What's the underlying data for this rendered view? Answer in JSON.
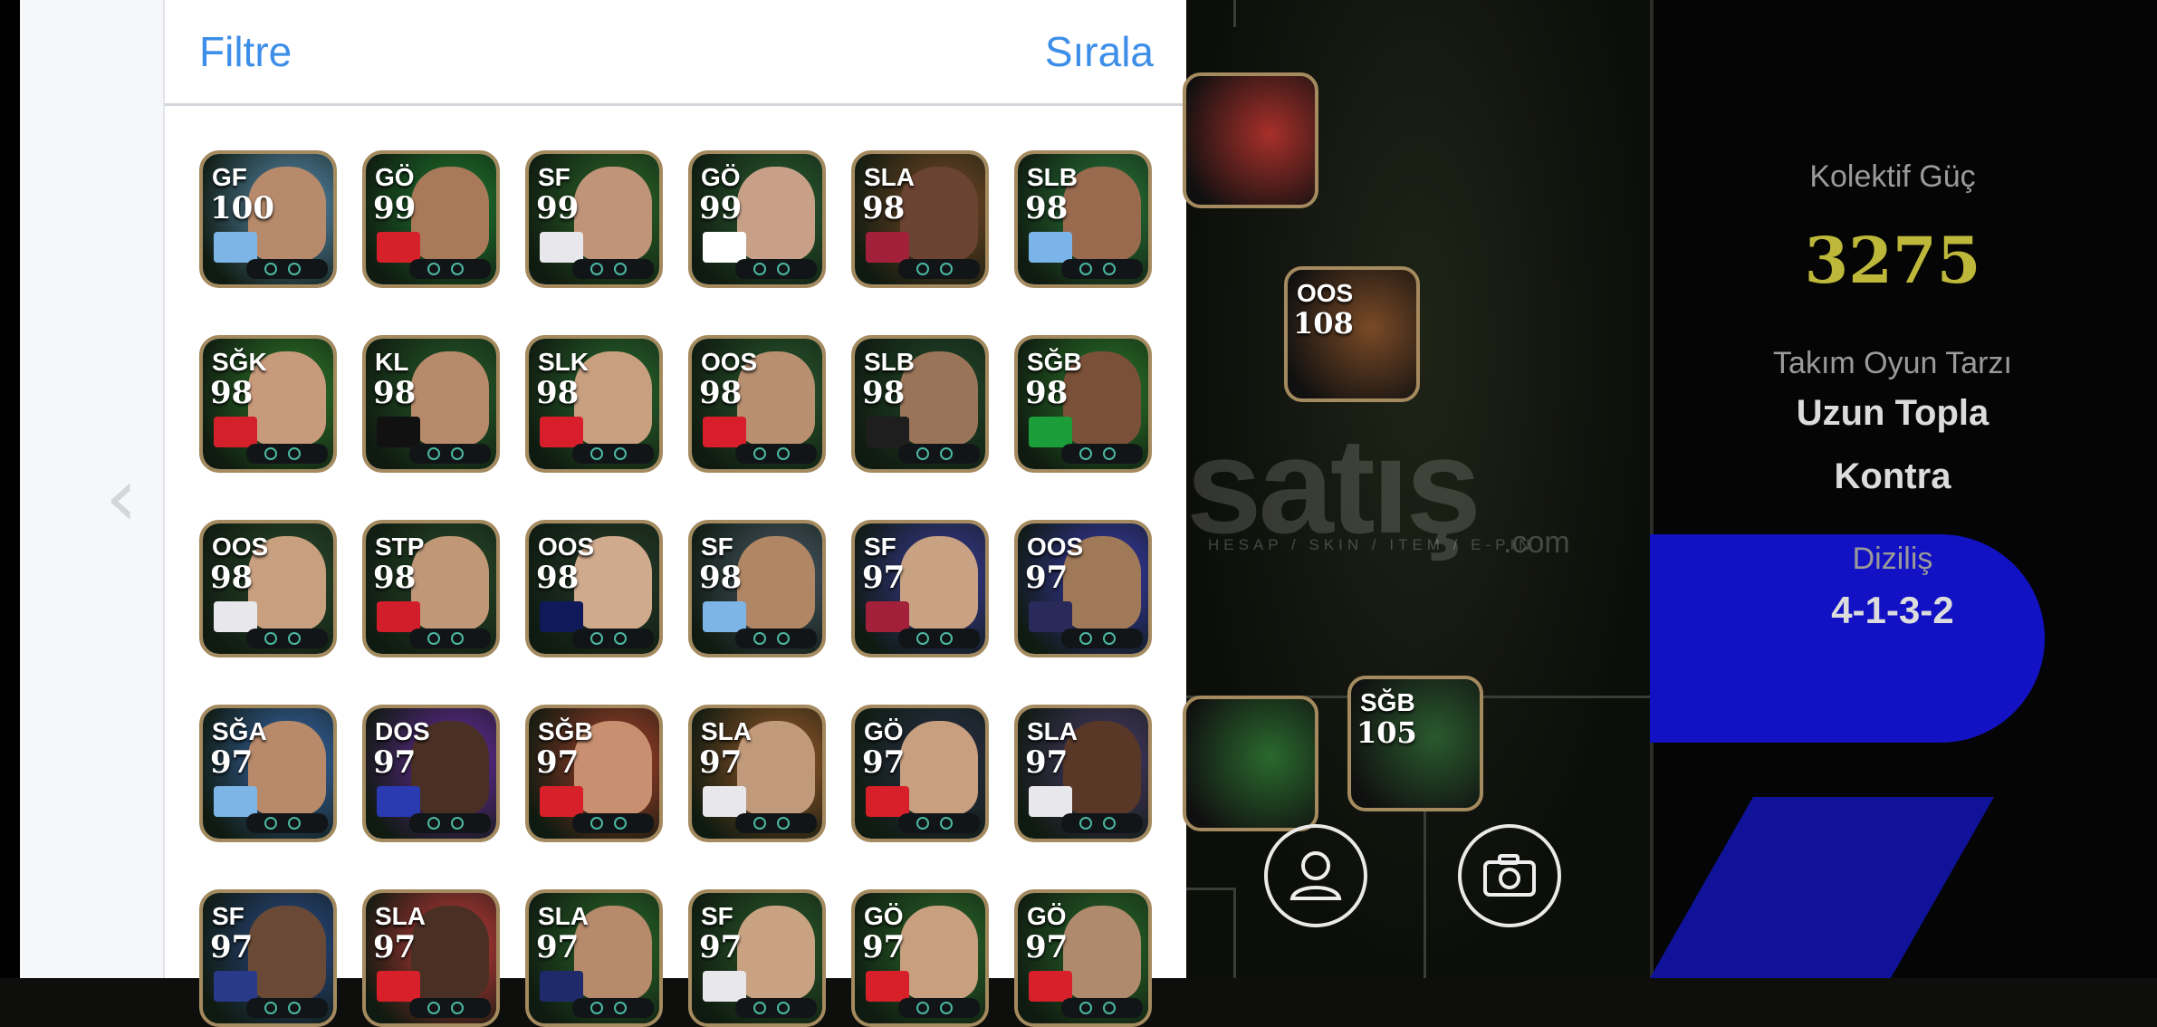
{
  "header": {
    "filter_label": "Filtre",
    "sort_label": "Sırala"
  },
  "back_icon": "chevron-left-icon",
  "players": [
    {
      "pos": "GF",
      "rating": "100",
      "theme": "#5a8fb5",
      "head": "#b68a6a",
      "emblem": "#7db6e6"
    },
    {
      "pos": "GÖ",
      "rating": "99",
      "theme": "#1f7a2e",
      "head": "#a87a5a",
      "emblem": "#d6202a"
    },
    {
      "pos": "SF",
      "rating": "99",
      "theme": "#2c6a2a",
      "head": "#c09478",
      "emblem": "#e8e8ec"
    },
    {
      "pos": "GÖ",
      "rating": "99",
      "theme": "#2b5f32",
      "head": "#c8a088",
      "emblem": "#ffffff"
    },
    {
      "pos": "SLA",
      "rating": "98",
      "theme": "#7a4a26",
      "head": "#6a4332",
      "emblem": "#a3203a"
    },
    {
      "pos": "SLB",
      "rating": "98",
      "theme": "#2a7a3a",
      "head": "#9a6a4e",
      "emblem": "#7bb4e8"
    },
    {
      "pos": "SĞK",
      "rating": "98",
      "theme": "#2f7a2a",
      "head": "#c89a7c",
      "emblem": "#d3202a"
    },
    {
      "pos": "KL",
      "rating": "98",
      "theme": "#275e2a",
      "head": "#b88a6c",
      "emblem": "#111111"
    },
    {
      "pos": "SLK",
      "rating": "98",
      "theme": "#2a6a2e",
      "head": "#c8a080",
      "emblem": "#d81e2a"
    },
    {
      "pos": "OOS",
      "rating": "98",
      "theme": "#2a5a2e",
      "head": "#b89070",
      "emblem": "#d81e2a"
    },
    {
      "pos": "SLB",
      "rating": "98",
      "theme": "#22482a",
      "head": "#9a7458",
      "emblem": "#1e1e1e"
    },
    {
      "pos": "SĞB",
      "rating": "98",
      "theme": "#2c7a2a",
      "head": "#7a5038",
      "emblem": "#1b9d3a"
    },
    {
      "pos": "OOS",
      "rating": "98",
      "theme": "#2a4a2c",
      "head": "#c8a080",
      "emblem": "#e8e8ec"
    },
    {
      "pos": "STP",
      "rating": "98",
      "theme": "#284a2a",
      "head": "#c09878",
      "emblem": "#d21e2a"
    },
    {
      "pos": "OOS",
      "rating": "98",
      "theme": "#263c2a",
      "head": "#d0aa8c",
      "emblem": "#101a5a"
    },
    {
      "pos": "SF",
      "rating": "98",
      "theme": "#4a5a6a",
      "head": "#b08664",
      "emblem": "#7db6e6"
    },
    {
      "pos": "SF",
      "rating": "97",
      "theme": "#3a3a9a",
      "head": "#c8a282",
      "emblem": "#a3203a"
    },
    {
      "pos": "OOS",
      "rating": "97",
      "theme": "#3a3ab0",
      "head": "#a07a58",
      "emblem": "#2a2a5a"
    },
    {
      "pos": "SĞA",
      "rating": "97",
      "theme": "#3a6ab0",
      "head": "#b88a6a",
      "emblem": "#7db6e6"
    },
    {
      "pos": "DOS",
      "rating": "97",
      "theme": "#6a2aa0",
      "head": "#4a3024",
      "emblem": "#2a3ab0"
    },
    {
      "pos": "SĞB",
      "rating": "97",
      "theme": "#a8402a",
      "head": "#c89070",
      "emblem": "#d8202a"
    },
    {
      "pos": "SLA",
      "rating": "97",
      "theme": "#9a5a2a",
      "head": "#c09a7a",
      "emblem": "#e8e8ec"
    },
    {
      "pos": "GÖ",
      "rating": "97",
      "theme": "#2a3048",
      "head": "#c8a080",
      "emblem": "#d8202a"
    },
    {
      "pos": "SLA",
      "rating": "97",
      "theme": "#4a3a6a",
      "head": "#5a3828",
      "emblem": "#e8e8ec"
    },
    {
      "pos": "SF",
      "rating": "97",
      "theme": "#2a4a8a",
      "head": "#6a4a36",
      "emblem": "#2a3a8a"
    },
    {
      "pos": "SLA",
      "rating": "97",
      "theme": "#c83a3a",
      "head": "#4a3024",
      "emblem": "#d8202a"
    },
    {
      "pos": "SLA",
      "rating": "97",
      "theme": "#2a6a2a",
      "head": "#b88a6c",
      "emblem": "#1e2a6a"
    },
    {
      "pos": "SF",
      "rating": "97",
      "theme": "#2a5a2a",
      "head": "#c8a282",
      "emblem": "#e8e8ec"
    },
    {
      "pos": "GÖ",
      "rating": "97",
      "theme": "#2a6a2a",
      "head": "#c8a080",
      "emblem": "#d8202a"
    },
    {
      "pos": "GÖ",
      "rating": "97",
      "theme": "#2a6a2a",
      "head": "#b08a6c",
      "emblem": "#d8202a"
    }
  ],
  "field_players": [
    {
      "pos": "",
      "rating": "",
      "theme": "#a8302a"
    },
    {
      "pos": "OOS",
      "rating": "108",
      "theme": "#7a4a26"
    },
    {
      "pos": "",
      "rating": "",
      "theme": "#2a6a2e"
    },
    {
      "pos": "SĞB",
      "rating": "105",
      "theme": "#2a5a2e"
    }
  ],
  "team_info": {
    "collective_label": "Kolektif Güç",
    "collective_value": "3275",
    "style_label": "Takım Oyun Tarzı",
    "style_line1": "Uzun Topla",
    "style_line2": "Kontra",
    "formation_label": "Diziliş",
    "formation_value": "4-1-3-2"
  },
  "watermark": {
    "main": "satış",
    "sub": "HESAP / SKIN / ITEM / E-PIN",
    "suffix": ".com"
  },
  "colors": {
    "accent_blue": "#3d8ee8",
    "collective_gold": "#bdb83a",
    "info_text": "#dcdcdc",
    "info_label": "#9a9a9a"
  },
  "icons": {
    "profile": "person-icon",
    "camera": "camera-icon"
  }
}
